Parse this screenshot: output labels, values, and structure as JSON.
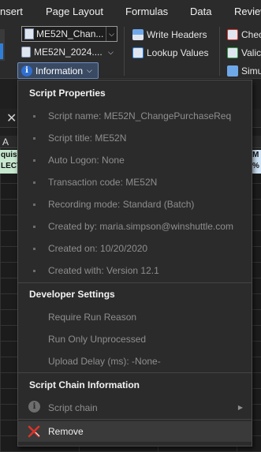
{
  "ribbon_tabs": [
    "nsert",
    "Page Layout",
    "Formulas",
    "Data",
    "Review"
  ],
  "ribbon": {
    "combo1": "ME52N_Chan...",
    "combo2": "ME52N_2024....",
    "information_button": "Information",
    "write_headers": "Write Headers",
    "lookup_values": "Lookup Values",
    "right_col": [
      "Chec",
      "Valic",
      "Simu"
    ]
  },
  "sheet": {
    "column_a": "A",
    "cell_left": [
      "quisi",
      "LECT"
    ],
    "cell_right": [
      "M",
      "%"
    ]
  },
  "menu": {
    "script_properties_header": "Script Properties",
    "script_properties": [
      "Script name: ME52N_ChangePurchaseReq",
      "Script title: ME52N",
      "Auto Logon: None",
      "Transaction code: ME52N",
      "Recording mode: Standard (Batch)",
      "Created by: maria.simpson@winshuttle.com",
      "Created on: 10/20/2020",
      "Created with: Version 12.1"
    ],
    "developer_settings_header": "Developer Settings",
    "developer_settings": [
      "Require Run Reason",
      "Run Only Unprocessed",
      "Upload Delay (ms): -None-"
    ],
    "script_chain_header": "Script Chain Information",
    "script_chain_item": "Script chain",
    "remove_label": "Remove"
  },
  "colors": {
    "menu_bg": "#2b2b2b",
    "disabled_text": "#8e8e8e",
    "remove_icon": "#d9342b",
    "info_button_bg": "#3a4a63"
  }
}
